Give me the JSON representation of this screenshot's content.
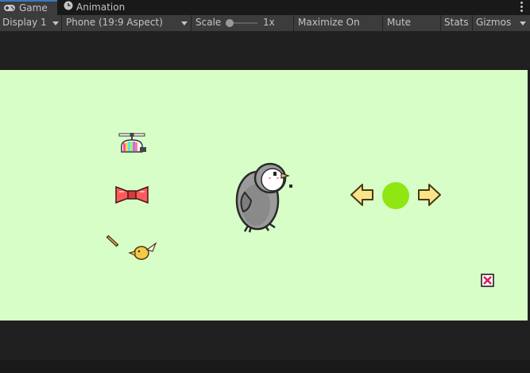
{
  "tabs": [
    {
      "label": "Game",
      "icon": "gamepad-icon",
      "active": true
    },
    {
      "label": "Animation",
      "icon": "animation-clock-icon",
      "active": false
    }
  ],
  "toolbar": {
    "display": "Display 1",
    "aspect": "Phone (19:9 Aspect)",
    "scale_label": "Scale",
    "scale_value": "1x",
    "maximize": "Maximize On Play",
    "mute": "Mute Audio",
    "stats": "Stats",
    "gizmos": "Gizmos"
  },
  "game": {
    "background_color": "#d8fec8",
    "items": [
      "propeller-hat-icon",
      "red-bowtie-icon",
      "wand-and-bird-icon"
    ],
    "character": "gray-penguin-character",
    "controls": [
      "left-arrow-button",
      "green-action-button",
      "right-arrow-button"
    ],
    "close": "close-x-button"
  }
}
